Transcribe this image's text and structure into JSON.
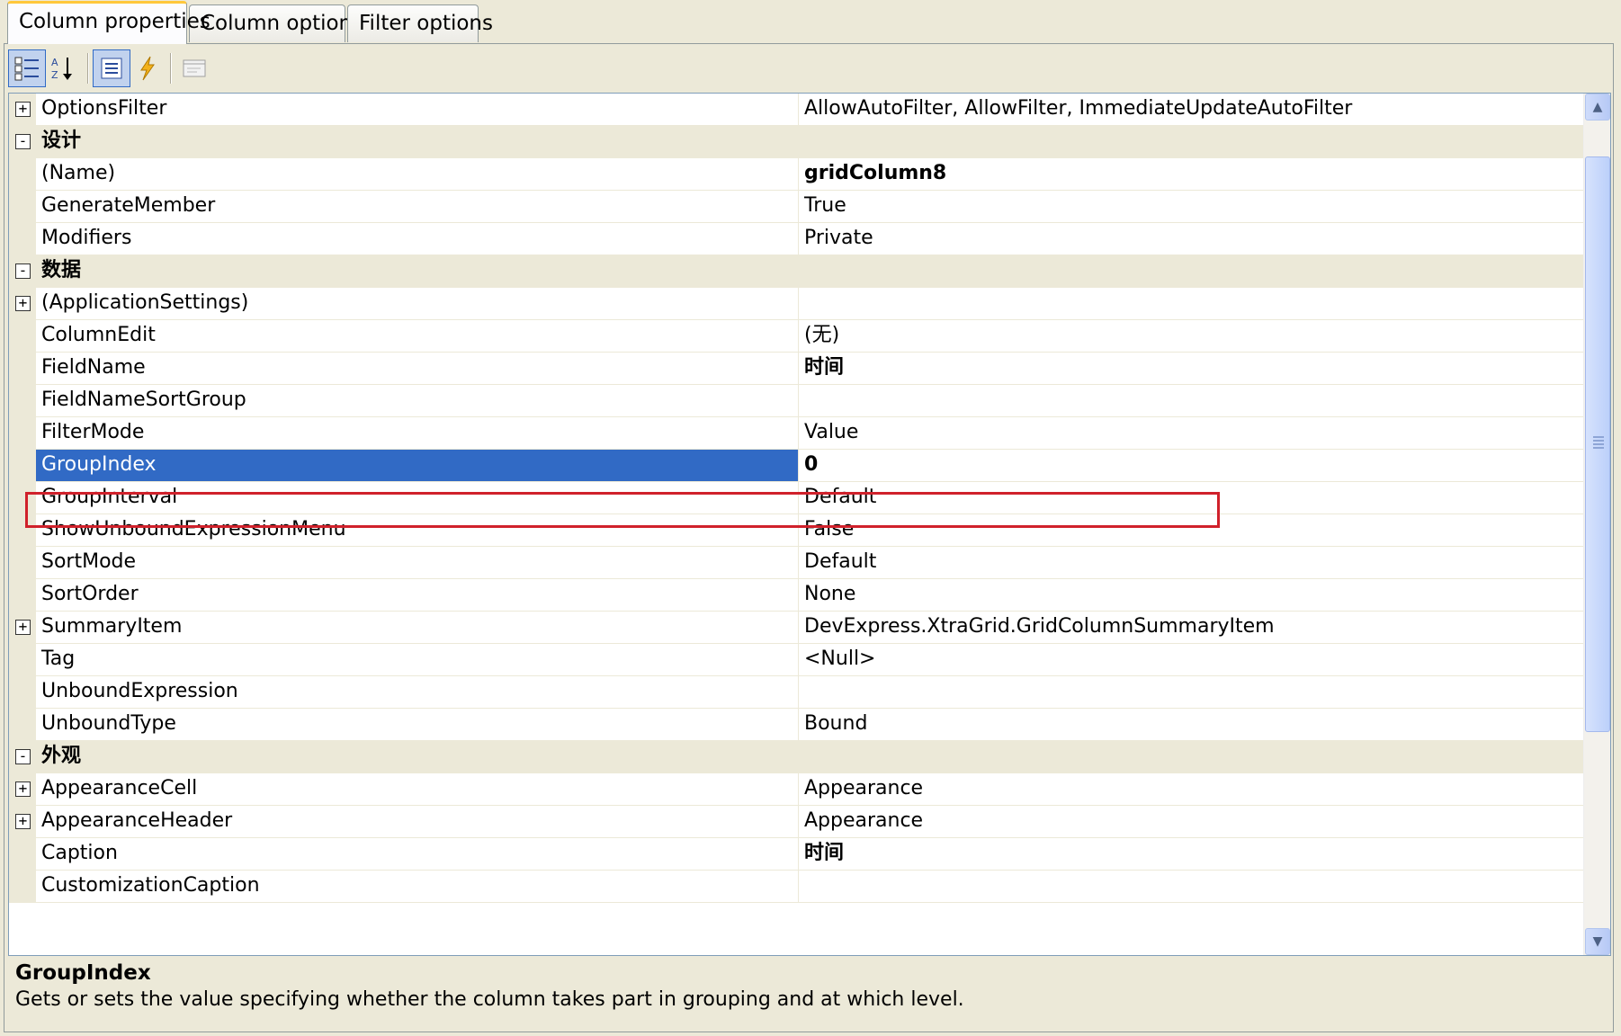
{
  "tabs": [
    {
      "label": "Column properties",
      "active": true
    },
    {
      "label": "Column options",
      "active": false
    },
    {
      "label": "Filter options",
      "active": false
    }
  ],
  "toolbar": {
    "buttons": [
      "categorized-icon",
      "alphabetical-icon",
      "properties-icon",
      "events-icon",
      "property-pages-icon"
    ]
  },
  "rows": [
    {
      "type": "property",
      "expander": "+",
      "name": "OptionsFilter",
      "value": "AllowAutoFilter, AllowFilter, ImmediateUpdateAutoFilter"
    },
    {
      "type": "category",
      "expander": "-",
      "name": "设计"
    },
    {
      "type": "property",
      "name": "(Name)",
      "value": "gridColumn8",
      "bold": true
    },
    {
      "type": "property",
      "name": "GenerateMember",
      "value": "True"
    },
    {
      "type": "property",
      "name": "Modifiers",
      "value": "Private"
    },
    {
      "type": "category",
      "expander": "-",
      "name": "数据"
    },
    {
      "type": "property",
      "expander": "+",
      "name": "(ApplicationSettings)",
      "value": ""
    },
    {
      "type": "property",
      "name": "ColumnEdit",
      "value": "(无)"
    },
    {
      "type": "property",
      "name": "FieldName",
      "value": "时间",
      "bold": true
    },
    {
      "type": "property",
      "name": "FieldNameSortGroup",
      "value": ""
    },
    {
      "type": "property",
      "name": "FilterMode",
      "value": "Value"
    },
    {
      "type": "property",
      "name": "GroupIndex",
      "value": "0",
      "selected": true
    },
    {
      "type": "property",
      "name": "GroupInterval",
      "value": "Default"
    },
    {
      "type": "property",
      "name": "ShowUnboundExpressionMenu",
      "value": "False"
    },
    {
      "type": "property",
      "name": "SortMode",
      "value": "Default"
    },
    {
      "type": "property",
      "name": "SortOrder",
      "value": "None"
    },
    {
      "type": "property",
      "expander": "+",
      "name": "SummaryItem",
      "value": "DevExpress.XtraGrid.GridColumnSummaryItem"
    },
    {
      "type": "property",
      "name": "Tag",
      "value": "<Null>"
    },
    {
      "type": "property",
      "name": "UnboundExpression",
      "value": ""
    },
    {
      "type": "property",
      "name": "UnboundType",
      "value": "Bound"
    },
    {
      "type": "category",
      "expander": "-",
      "name": "外观"
    },
    {
      "type": "property",
      "expander": "+",
      "name": "AppearanceCell",
      "value": "Appearance"
    },
    {
      "type": "property",
      "expander": "+",
      "name": "AppearanceHeader",
      "value": "Appearance"
    },
    {
      "type": "property",
      "name": "Caption",
      "value": "时间",
      "bold": true
    },
    {
      "type": "property",
      "name": "CustomizationCaption",
      "value": ""
    }
  ],
  "description": {
    "title": "GroupIndex",
    "text": "Gets or sets the value specifying whether the column takes part in grouping and at which level."
  },
  "colors": {
    "selection": "#316ac5",
    "highlight_box": "#d0212b",
    "background": "#ece9d8"
  }
}
